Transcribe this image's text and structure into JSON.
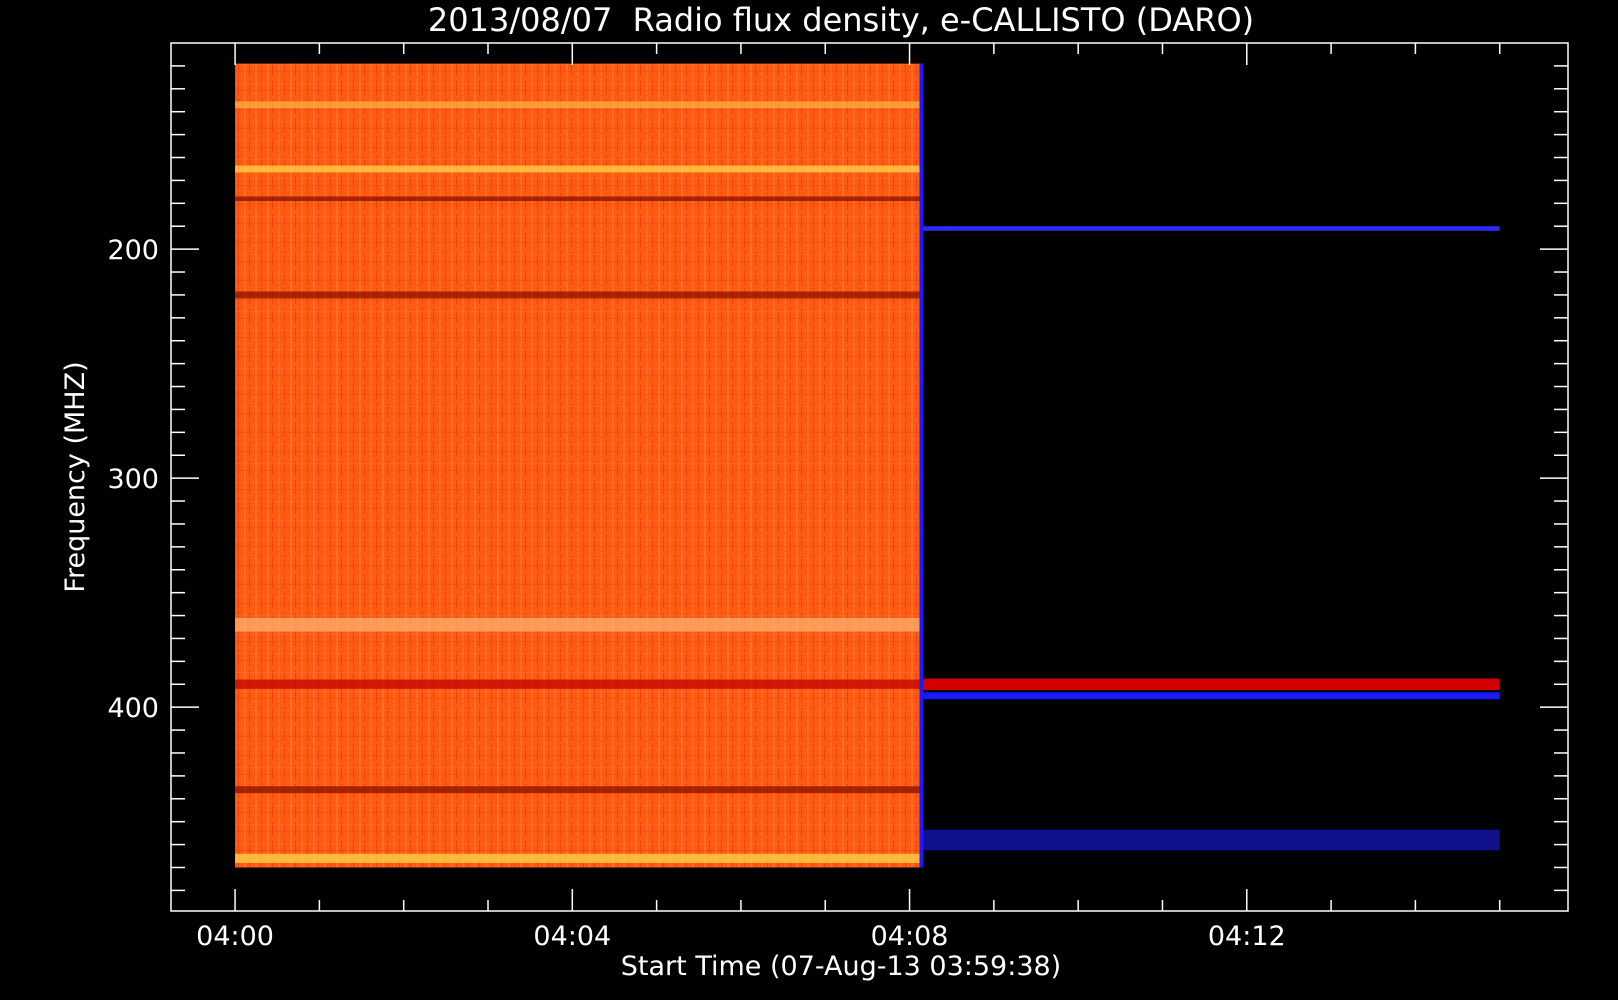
{
  "chart_data": {
    "type": "heatmap",
    "title": "2013/08/07  Radio flux density, e-CALLISTO (DARO)",
    "xlabel": "Start Time (07-Aug-13 03:59:38)",
    "ylabel": "Frequency (MHZ)",
    "x_ticks": [
      {
        "minute": 0,
        "label": "04:00"
      },
      {
        "minute": 4,
        "label": "04:04"
      },
      {
        "minute": 8,
        "label": "04:08"
      },
      {
        "minute": 12,
        "label": "04:12"
      }
    ],
    "y_ticks": [
      {
        "mhz": 200,
        "label": "200"
      },
      {
        "mhz": 300,
        "label": "300"
      },
      {
        "mhz": 400,
        "label": "400"
      }
    ],
    "xlim_minutes": [
      -0.76,
      15.81
    ],
    "ylim_mhz": [
      110,
      489
    ],
    "data_time_range_minutes": [
      0,
      15.0
    ],
    "data_freq_range_mhz": [
      119,
      470
    ],
    "active_segment_end_minute": 8.13,
    "colors": {
      "background": "#000000",
      "active_fill": "#ff5a14",
      "inactive_fill": "#000000",
      "band_blue": "#1a1aff",
      "band_red": "#d40000",
      "band_yellow": "#ffd84a",
      "band_dark": "#8a1000",
      "axis": "#ffffff"
    },
    "inactive_bands": [
      {
        "mhz": 191,
        "thickness_mhz": 2,
        "color": "#2b2bff"
      },
      {
        "mhz": 390,
        "thickness_mhz": 5,
        "color": "#d40000"
      },
      {
        "mhz": 395,
        "thickness_mhz": 3,
        "color": "#1a1aff"
      },
      {
        "mhz": 458,
        "thickness_mhz": 9,
        "color": "#10108a"
      }
    ],
    "active_bands": [
      {
        "mhz": 137,
        "thickness_mhz": 3,
        "color": "#ffb040"
      },
      {
        "mhz": 165,
        "thickness_mhz": 3,
        "color": "#ffd84a"
      },
      {
        "mhz": 178,
        "thickness_mhz": 2,
        "color": "#8a1000"
      },
      {
        "mhz": 220,
        "thickness_mhz": 3,
        "color": "#8a1000"
      },
      {
        "mhz": 364,
        "thickness_mhz": 6,
        "color": "#ffb070"
      },
      {
        "mhz": 390,
        "thickness_mhz": 4,
        "color": "#c00000"
      },
      {
        "mhz": 436,
        "thickness_mhz": 3,
        "color": "#8a1000"
      },
      {
        "mhz": 466,
        "thickness_mhz": 4,
        "color": "#ffd84a"
      }
    ]
  }
}
